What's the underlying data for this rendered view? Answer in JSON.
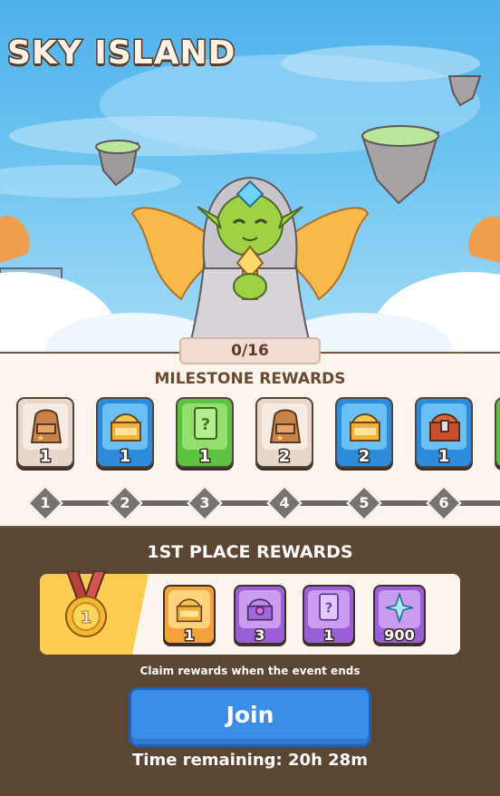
{
  "event": {
    "title": "SKY ISLAND",
    "progress": "0/16"
  },
  "milestones": {
    "title": "MILESTONE REWARDS",
    "items": [
      {
        "icon": "backpack-icon",
        "qty": "1",
        "color": "tan"
      },
      {
        "icon": "gold-chest-icon",
        "qty": "1",
        "color": "blue"
      },
      {
        "icon": "mystery-card-icon",
        "qty": "1",
        "color": "green"
      },
      {
        "icon": "backpack-icon",
        "qty": "2",
        "color": "tan"
      },
      {
        "icon": "gold-chest-icon",
        "qty": "2",
        "color": "blue"
      },
      {
        "icon": "treasure-chest-icon",
        "qty": "1",
        "color": "blue"
      }
    ],
    "nodes": [
      "1",
      "2",
      "3",
      "4",
      "5",
      "6"
    ]
  },
  "first_place": {
    "title": "1ST PLACE REWARDS",
    "medal": "1",
    "rewards": [
      {
        "icon": "gold-chest-icon",
        "qty": "1",
        "color": "orange"
      },
      {
        "icon": "purple-chest-icon",
        "qty": "3",
        "color": "purple"
      },
      {
        "icon": "mystery-card-icon",
        "qty": "1",
        "color": "purple"
      },
      {
        "icon": "sparkle-gem-icon",
        "qty": "900",
        "color": "purple"
      }
    ]
  },
  "claim_note": "Claim rewards when the event ends",
  "join_label": "Join",
  "time_remaining": "Time remaining: 20h 28m",
  "colors": {
    "background": "#5a4632",
    "join_button": "#3b8ee8",
    "medal_gold": "#f5b82e"
  }
}
